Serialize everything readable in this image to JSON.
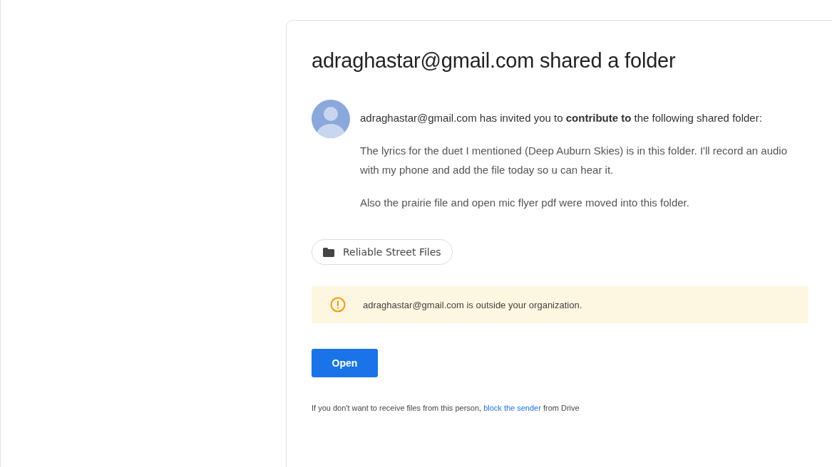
{
  "title": "adraghastar@gmail.com shared a folder",
  "invitation": "adraghastar@gmail.com has invited you to **contribute to** the following shared folder:",
  "message": [
    "The lyrics for the duet I mentioned (Deep Auburn Skies) is in this folder. I'll record an audio with my phone and add the file today so u can hear it.",
    "Also the prairie file and open mic flyer pdf were moved into this folder."
  ],
  "folder_chip": {
    "label": "Reliable Street Files"
  },
  "warning": "adraghastar@gmail.com is outside your organization.",
  "open_button": "Open",
  "footer": {
    "before": "If you don't want to receive files from this person, ",
    "link": "block the sender",
    "after": " from Drive"
  }
}
